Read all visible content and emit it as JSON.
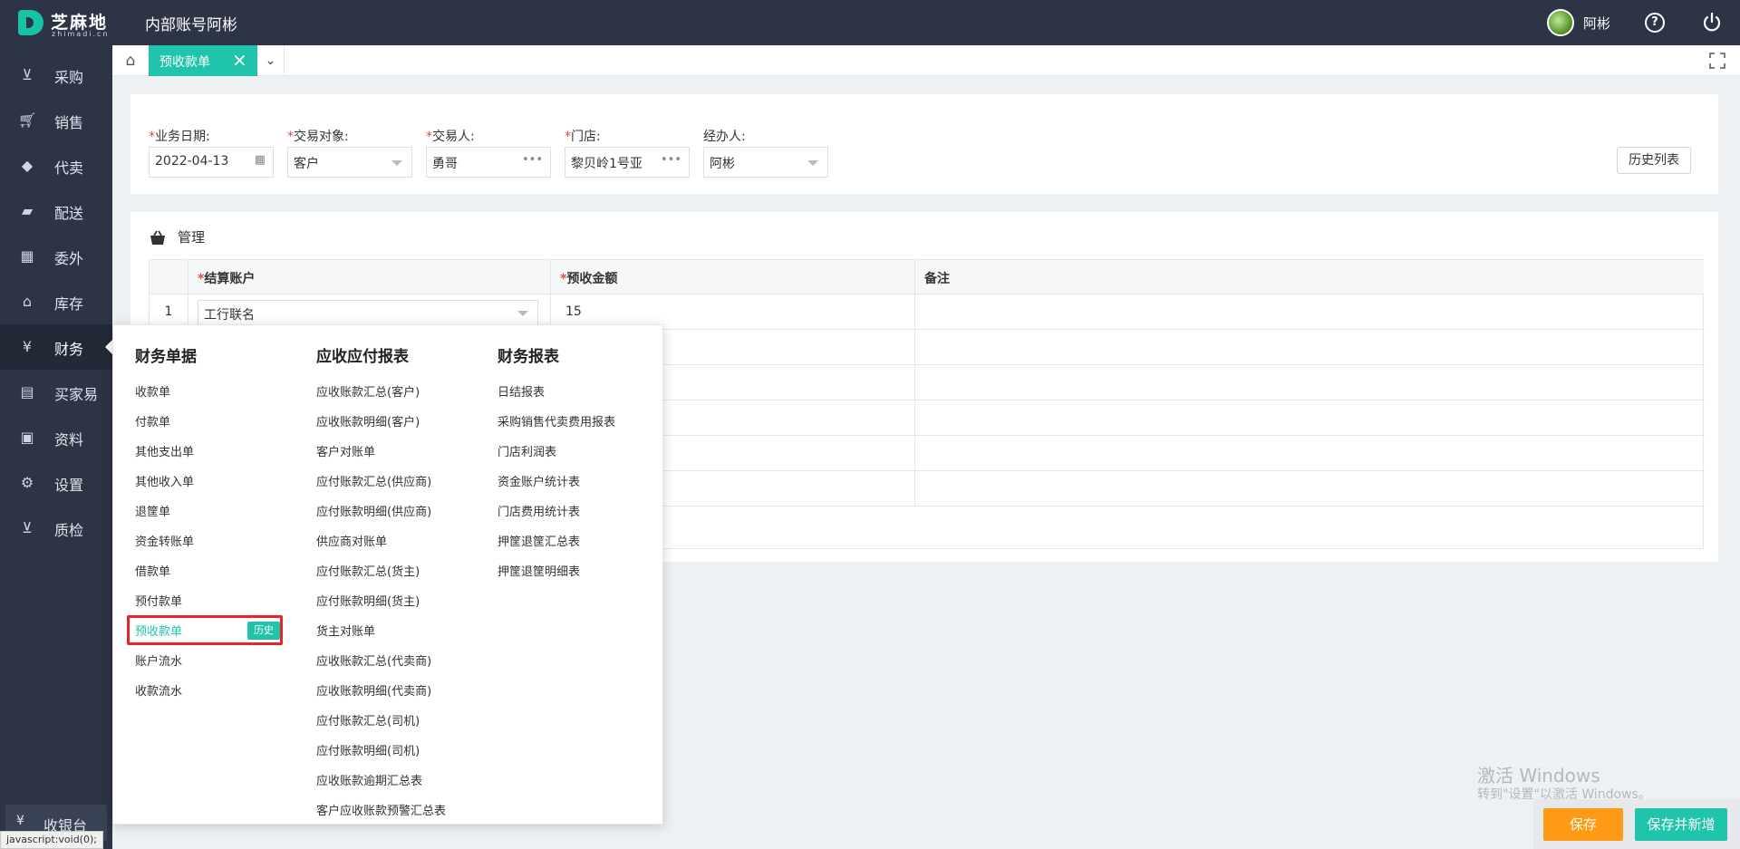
{
  "app": {
    "logo_text": "芝麻地",
    "logo_sub": "zhimadi.cn",
    "title": "内部账号阿彬",
    "user": "阿彬",
    "accent": "#20c4ab"
  },
  "sidebar": {
    "items": [
      {
        "label": "采购",
        "icon": "basket-icon"
      },
      {
        "label": "销售",
        "icon": "cart-icon"
      },
      {
        "label": "代卖",
        "icon": "tag-icon"
      },
      {
        "label": "配送",
        "icon": "truck-icon"
      },
      {
        "label": "委外",
        "icon": "building-icon"
      },
      {
        "label": "库存",
        "icon": "warehouse-icon"
      },
      {
        "label": "财务",
        "icon": "yen-shield-icon"
      },
      {
        "label": "买家易",
        "icon": "store-icon"
      },
      {
        "label": "资料",
        "icon": "printer-icon"
      },
      {
        "label": "设置",
        "icon": "gear-icon"
      },
      {
        "label": "质检",
        "icon": "basket-icon"
      }
    ],
    "cashier": "收银台"
  },
  "tabs": {
    "active": "预收款单"
  },
  "form": {
    "date": {
      "label": "业务日期:",
      "value": "2022-04-13"
    },
    "target": {
      "label": "交易对象:",
      "value": "客户"
    },
    "person": {
      "label": "交易人:",
      "value": "勇哥"
    },
    "store": {
      "label": "门店:",
      "value": "黎贝岭1号亚"
    },
    "handler": {
      "label": "经办人:",
      "value": "阿彬"
    },
    "history_button": "历史列表"
  },
  "grid": {
    "title": "管理",
    "columns": [
      "结算账户",
      "预收金额",
      "备注"
    ],
    "rows": [
      {
        "no": "1",
        "account": "工行联名",
        "amount": "15",
        "note": ""
      }
    ]
  },
  "menu": {
    "col1": {
      "title": "财务单据",
      "items": [
        "收款单",
        "付款单",
        "其他支出单",
        "其他收入单",
        "退筐单",
        "资金转账单",
        "借款单",
        "预付款单",
        "预收款单",
        "账户流水",
        "收款流水"
      ],
      "highlight_badge": "历史"
    },
    "col2": {
      "title": "应收应付报表",
      "items": [
        "应收账款汇总(客户)",
        "应收账款明细(客户)",
        "客户对账单",
        "应付账款汇总(供应商)",
        "应付账款明细(供应商)",
        "供应商对账单",
        "应付账款汇总(货主)",
        "应付账款明细(货主)",
        "货主对账单",
        "应收账款汇总(代卖商)",
        "应收账款明细(代卖商)",
        "应付账款汇总(司机)",
        "应付账款明细(司机)",
        "应收账款逾期汇总表",
        "客户应收账款预警汇总表"
      ]
    },
    "col3": {
      "title": "财务报表",
      "items": [
        "日结报表",
        "采购销售代卖费用报表",
        "门店利润表",
        "资金账户统计表",
        "门店费用统计表",
        "押筐退筐汇总表",
        "押筐退筐明细表"
      ]
    }
  },
  "actions": {
    "save": "保存",
    "save_new": "保存并新增"
  },
  "watermark": {
    "line1": "激活 Windows",
    "line2": "转到\"设置\"以激活 Windows。"
  },
  "status_url": "javascript:void(0);"
}
